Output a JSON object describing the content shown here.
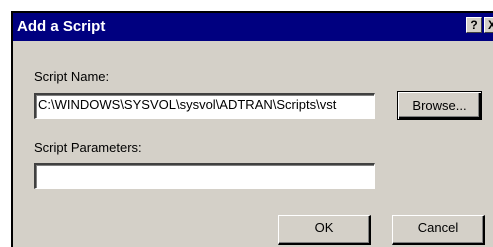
{
  "window": {
    "title": "Add a Script",
    "help_glyph": "?",
    "close_glyph": "X"
  },
  "script_name": {
    "label": "Script Name:",
    "value": "C:\\WINDOWS\\SYSVOL\\sysvol\\ADTRAN\\Scripts\\vst",
    "browse_label": "Browse..."
  },
  "script_parameters": {
    "label": "Script Parameters:",
    "value": ""
  },
  "buttons": {
    "ok_label": "OK",
    "cancel_label": "Cancel"
  },
  "colors": {
    "titlebar": "#000080",
    "face": "#d4d0c8"
  }
}
